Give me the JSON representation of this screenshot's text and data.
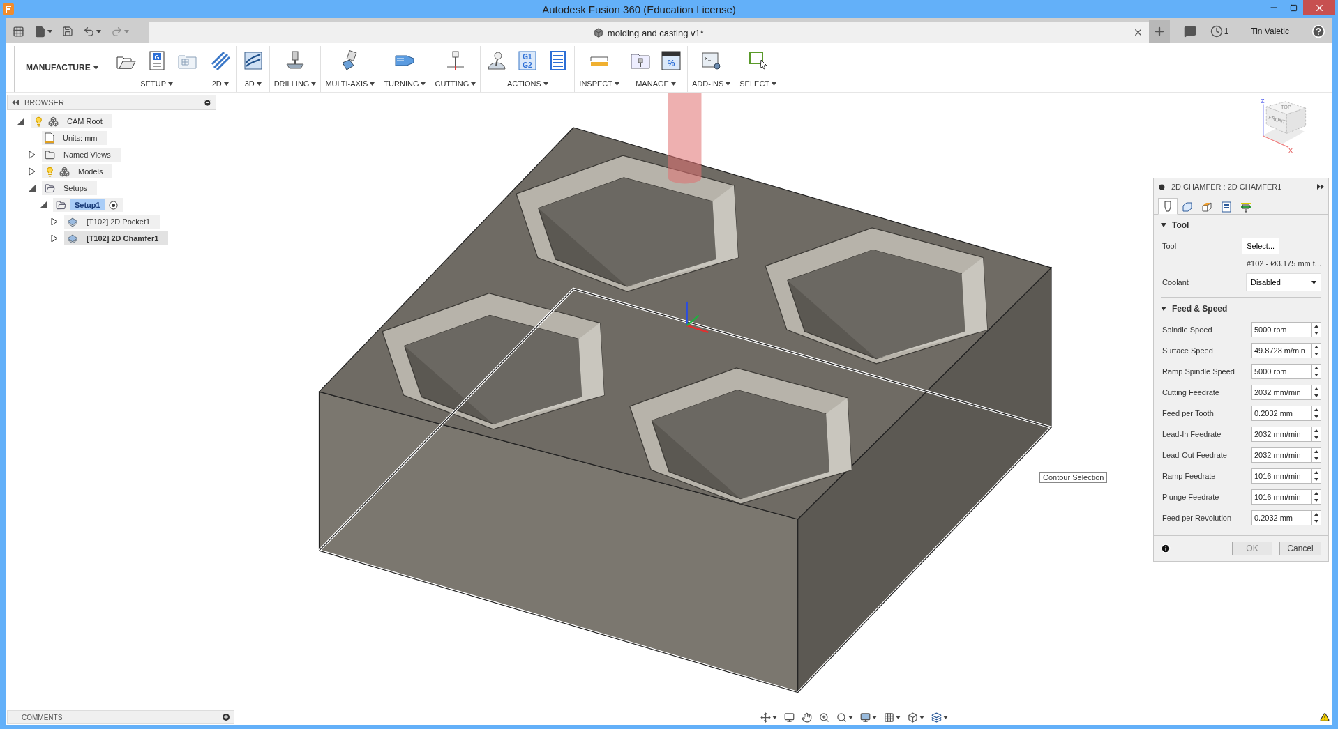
{
  "window": {
    "title": "Autodesk Fusion 360 (Education License)"
  },
  "document_tab": {
    "title": "molding and casting v1*"
  },
  "header": {
    "job_count": "1",
    "user": "Tin Valetic"
  },
  "workspace": "MANUFACTURE",
  "toolbar_groups": [
    {
      "label": "SETUP",
      "tools": [
        {
          "kind": "open-folder"
        },
        {
          "kind": "document",
          "text": "G"
        },
        {
          "kind": "grid-folder"
        }
      ]
    },
    {
      "label": "2D",
      "tools": [
        {
          "kind": "stripes"
        }
      ]
    },
    {
      "label": "3D",
      "tools": [
        {
          "kind": "wave"
        }
      ]
    },
    {
      "label": "DRILLING",
      "tools": [
        {
          "kind": "drill"
        }
      ]
    },
    {
      "label": "MULTI-AXIS",
      "tools": [
        {
          "kind": "bit"
        }
      ]
    },
    {
      "label": "TURNING",
      "tools": [
        {
          "kind": "lathe"
        }
      ]
    },
    {
      "label": "CUTTING",
      "tools": [
        {
          "kind": "cutter"
        }
      ]
    },
    {
      "label": "ACTIONS",
      "tools": [
        {
          "kind": "joystick"
        },
        {
          "kind": "code",
          "text": "G1 G2"
        },
        {
          "kind": "sheet"
        }
      ]
    },
    {
      "label": "INSPECT",
      "tools": [
        {
          "kind": "ruler"
        }
      ]
    },
    {
      "label": "MANAGE",
      "tools": [
        {
          "kind": "tool-folder"
        },
        {
          "kind": "percent-window",
          "text": "%"
        }
      ]
    },
    {
      "label": "ADD-INS",
      "tools": [
        {
          "kind": "terminal"
        }
      ]
    },
    {
      "label": "SELECT",
      "tools": [
        {
          "kind": "select"
        }
      ]
    }
  ],
  "browser": {
    "title": "BROWSER",
    "tree": [
      {
        "label": "CAM Root",
        "kind": "component",
        "visible": true,
        "expanded": true,
        "selected": false,
        "editing": false,
        "children": [
          {
            "label": "Units: mm",
            "kind": "units",
            "selected": false,
            "editing": false
          },
          {
            "label": "Named Views",
            "kind": "folder",
            "expanded": false,
            "selected": false,
            "editing": false
          },
          {
            "label": "Models",
            "kind": "component",
            "visible": true,
            "expanded": false,
            "selected": false,
            "editing": false
          },
          {
            "label": "Setups",
            "kind": "setups",
            "expanded": true,
            "selected": false,
            "editing": false,
            "children": [
              {
                "label": "Setup1",
                "kind": "setups",
                "expanded": true,
                "selected": true,
                "editing": false,
                "active": true,
                "children": [
                  {
                    "label": "[T102] 2D Pocket1",
                    "kind": "operation",
                    "expanded": false,
                    "selected": false,
                    "editing": false
                  },
                  {
                    "label": "[T102] 2D Chamfer1",
                    "kind": "operation",
                    "expanded": false,
                    "selected": false,
                    "editing": true
                  }
                ]
              }
            ]
          }
        ]
      }
    ]
  },
  "view_cube": {
    "top": "TOP",
    "front": "FRONT",
    "z": "Z",
    "x": "X"
  },
  "tooltip": "Contour Selection",
  "panel": {
    "title": "2D CHAMFER : 2D CHAMFER1",
    "tabs": [
      {
        "kind": "tool",
        "selected": true
      },
      {
        "kind": "geometry",
        "selected": false
      },
      {
        "kind": "heights",
        "selected": false
      },
      {
        "kind": "passes",
        "selected": false
      },
      {
        "kind": "linking",
        "selected": false
      }
    ],
    "tool_section": {
      "title": "Tool",
      "expanded": true,
      "tool_label": "Tool",
      "tool_button": "Select...",
      "tool_note": "#102 - Ø3.175 mm t...",
      "coolant_label": "Coolant",
      "coolant_value": "Disabled"
    },
    "feed_section": {
      "title": "Feed & Speed",
      "expanded": true,
      "fields": [
        {
          "label": "Spindle Speed",
          "value": "5000 rpm"
        },
        {
          "label": "Surface Speed",
          "value": "49.8728 m/min"
        },
        {
          "label": "Ramp Spindle Speed",
          "value": "5000 rpm"
        },
        {
          "label": "Cutting Feedrate",
          "value": "2032 mm/min"
        },
        {
          "label": "Feed per Tooth",
          "value": "0.2032 mm"
        },
        {
          "label": "Lead-In Feedrate",
          "value": "2032 mm/min"
        },
        {
          "label": "Lead-Out Feedrate",
          "value": "2032 mm/min"
        },
        {
          "label": "Ramp Feedrate",
          "value": "1016 mm/min"
        },
        {
          "label": "Plunge Feedrate",
          "value": "1016 mm/min"
        },
        {
          "label": "Feed per Revolution",
          "value": "0.2032 mm"
        }
      ]
    },
    "buttons": [
      {
        "label": "OK",
        "kind": "ok"
      },
      {
        "label": "Cancel",
        "kind": "cancel"
      }
    ]
  },
  "comments": {
    "title": "COMMENTS"
  }
}
